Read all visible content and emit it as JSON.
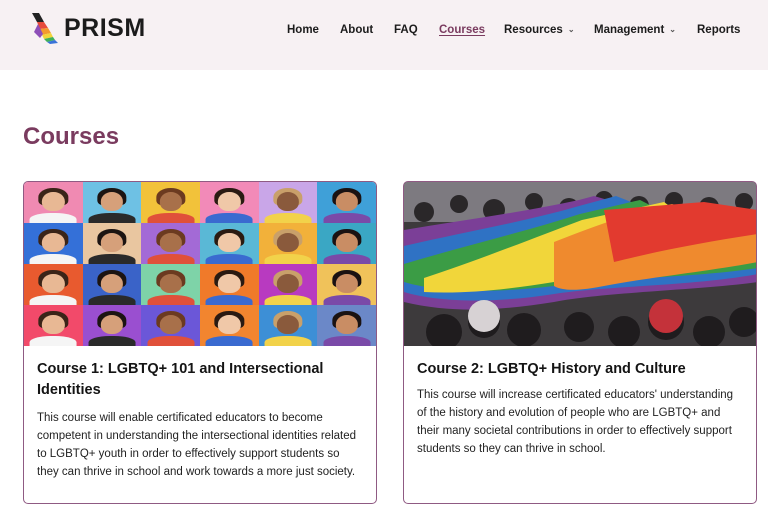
{
  "brand": {
    "name": "PRISM"
  },
  "nav": {
    "items": [
      {
        "label": "Home"
      },
      {
        "label": "About"
      },
      {
        "label": "FAQ"
      },
      {
        "label": "Courses"
      },
      {
        "label": "Resources"
      },
      {
        "label": "Management"
      },
      {
        "label": "Reports"
      }
    ]
  },
  "page": {
    "title": "Courses"
  },
  "courses": [
    {
      "title": "Course 1: LGBTQ+ 101 and Intersectional Identities",
      "description": "This course will enable certificated educators to become competent in understanding the intersectional identities related to LGBTQ+ youth in order to effectively support students so they can thrive in school and work towards a more just society."
    },
    {
      "title": "Course 2: LGBTQ+ History and Culture",
      "description": "This course will increase certificated educators' understanding of the history and evolution of people who are LGBTQ+ and their many societal contributions in order to effectively support students so they can thrive in school."
    }
  ],
  "colors": {
    "accent": "#7a3b5f",
    "header_bg": "#f7f1f3",
    "card_border": "#8f5a83"
  },
  "icons": {
    "brand": "prism-rainbow-logo-icon",
    "dropdown": "chevron-down-icon"
  }
}
